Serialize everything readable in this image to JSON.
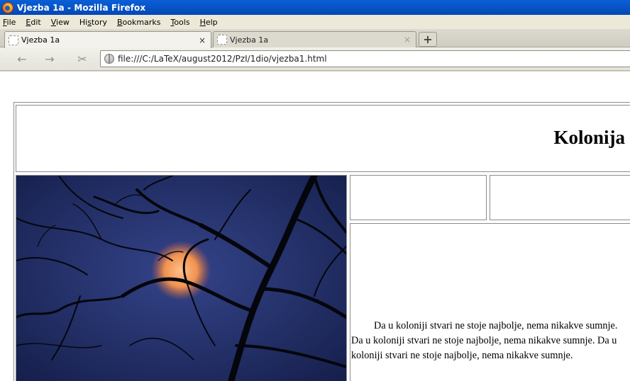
{
  "window": {
    "title": "Vjezba 1a - Mozilla Firefox"
  },
  "menubar": {
    "items": [
      {
        "label": "File",
        "accel": "F",
        "rest": "ile"
      },
      {
        "label": "Edit",
        "accel": "E",
        "rest": "dit"
      },
      {
        "label": "View",
        "accel": "V",
        "rest": "iew"
      },
      {
        "label": "History",
        "pre": "Hi",
        "accel": "s",
        "rest": "tory"
      },
      {
        "label": "Bookmarks",
        "accel": "B",
        "rest": "ookmarks"
      },
      {
        "label": "Tools",
        "accel": "T",
        "rest": "ools"
      },
      {
        "label": "Help",
        "accel": "H",
        "rest": "elp"
      }
    ]
  },
  "tabs": [
    {
      "label": "Vjezba 1a",
      "close": "×",
      "active": true
    },
    {
      "label": "Vjezba 1a",
      "close": "×",
      "active": false
    }
  ],
  "new_tab": {
    "label": "+"
  },
  "toolbar": {
    "back_icon": "←",
    "forward_icon": "→",
    "tools_icon": "✂"
  },
  "address": {
    "url": "file:///C:/LaTeX/august2012/PzI/1dio/vjezba1.html"
  },
  "page": {
    "heading": "Kolonija",
    "paragraph": "Da u koloniji stvari ne stoje najbolje, nema nikakve sumnje. Da u koloniji stvari ne stoje najbolje, nema nikakve sumnje. Da u koloniji stvari ne stoje najbolje, nema nikakve sumnje.",
    "image": {
      "subject": "moon-through-branches-photo",
      "colors": {
        "sky": "#1c2a5c",
        "moon": "#f09a55",
        "branches": "#05070c"
      }
    }
  }
}
